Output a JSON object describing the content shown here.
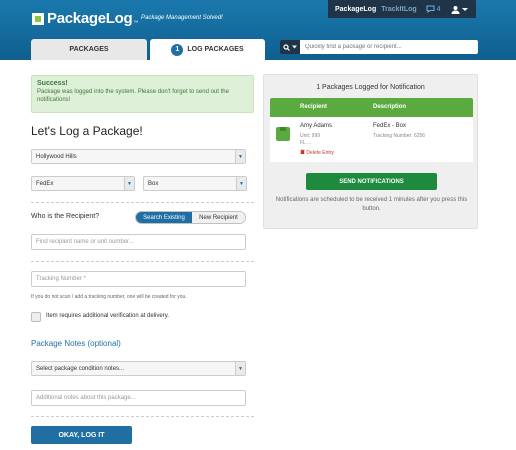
{
  "header": {
    "logo_text": "PackageLog",
    "logo_tm": "™",
    "tagline": "Package Management Solved!",
    "nav_brand": "PackageLog",
    "nav_trackit": "TrackItLog",
    "message_count": "4",
    "colors": {
      "header_bg": "#1b79ad",
      "nav_bg": "#1f3447",
      "accent": "#1f6fa3",
      "green": "#5aaa3f"
    }
  },
  "tabs": [
    {
      "label": "PACKAGES"
    },
    {
      "number": "1",
      "label": "LOG PACKAGES"
    }
  ],
  "search": {
    "placeholder": "Quickly find a package or recipient..."
  },
  "alert": {
    "title": "Success!",
    "message": "Package was logged into the system. Please don't forget to send out the notifications!"
  },
  "form": {
    "heading": "Let's Log a Package!",
    "location": "Hollywood Hills",
    "carrier": "FedEx",
    "package_type": "Box",
    "recipient_label": "Who is the Recipient?",
    "toggle_existing": "Search Existing",
    "toggle_new": "New Recipient",
    "recipient_placeholder": "Find recipient name or unit number...",
    "tracking_placeholder": "Tracking Number *",
    "tracking_hint": "If you do not scan / add a tracking number, one will be created for you.",
    "verify_label": "Item requires additional verification at delivery.",
    "notes_heading": "Package Notes (optional)",
    "condition_placeholder": "Select package condition notes...",
    "notes_placeholder": "Additional notes about this package...",
    "submit_label": "OKAY, LOG IT"
  },
  "panel": {
    "title": "1 Packages Logged for Notification",
    "col_recipient": "Recipient",
    "col_description": "Description",
    "row": {
      "name": "Amy Adams",
      "unit": "Unit: 999",
      "floor": "FL ...",
      "delete": "Delete Entry",
      "description": "FedEx - Box",
      "tracking": "Tracking Number: 6256"
    },
    "send_label": "SEND NOTIFICATIONS",
    "note": "Notifications are scheduled to be received 1 minutes after you press this button."
  }
}
